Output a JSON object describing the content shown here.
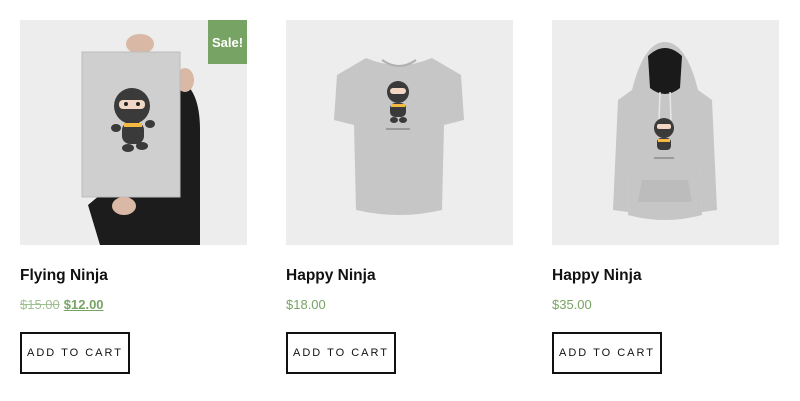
{
  "products": [
    {
      "name": "Flying Ninja",
      "regular_price": "$15.00",
      "sale_price": "$12.00",
      "badge": "Sale!",
      "button": "ADD TO CART",
      "image": "poster-ninja-image"
    },
    {
      "name": "Happy Ninja",
      "price": "$18.00",
      "button": "ADD TO CART",
      "image": "tshirt-ninja-image"
    },
    {
      "name": "Happy Ninja",
      "price": "$35.00",
      "button": "ADD TO CART",
      "image": "hoodie-ninja-image"
    }
  ],
  "colors": {
    "accent": "#77a464",
    "thumb_bg": "#ededed",
    "text": "#111111"
  }
}
